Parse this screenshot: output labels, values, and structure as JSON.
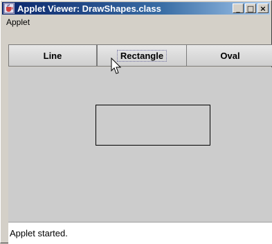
{
  "window": {
    "title": "Applet Viewer: DrawShapes.class"
  },
  "titlebar_buttons": {
    "minimize": "_",
    "maximize": "□",
    "close": "×"
  },
  "menu": {
    "items": [
      "Applet"
    ]
  },
  "buttons": [
    {
      "label": "Line"
    },
    {
      "label": "Rectangle",
      "focused": true
    },
    {
      "label": "Oval"
    }
  ],
  "status": {
    "text": "Applet started."
  },
  "colors": {
    "title_active": "#0a246a",
    "canvas_bg": "#cccccc",
    "window_bg": "#d4d0c8"
  }
}
